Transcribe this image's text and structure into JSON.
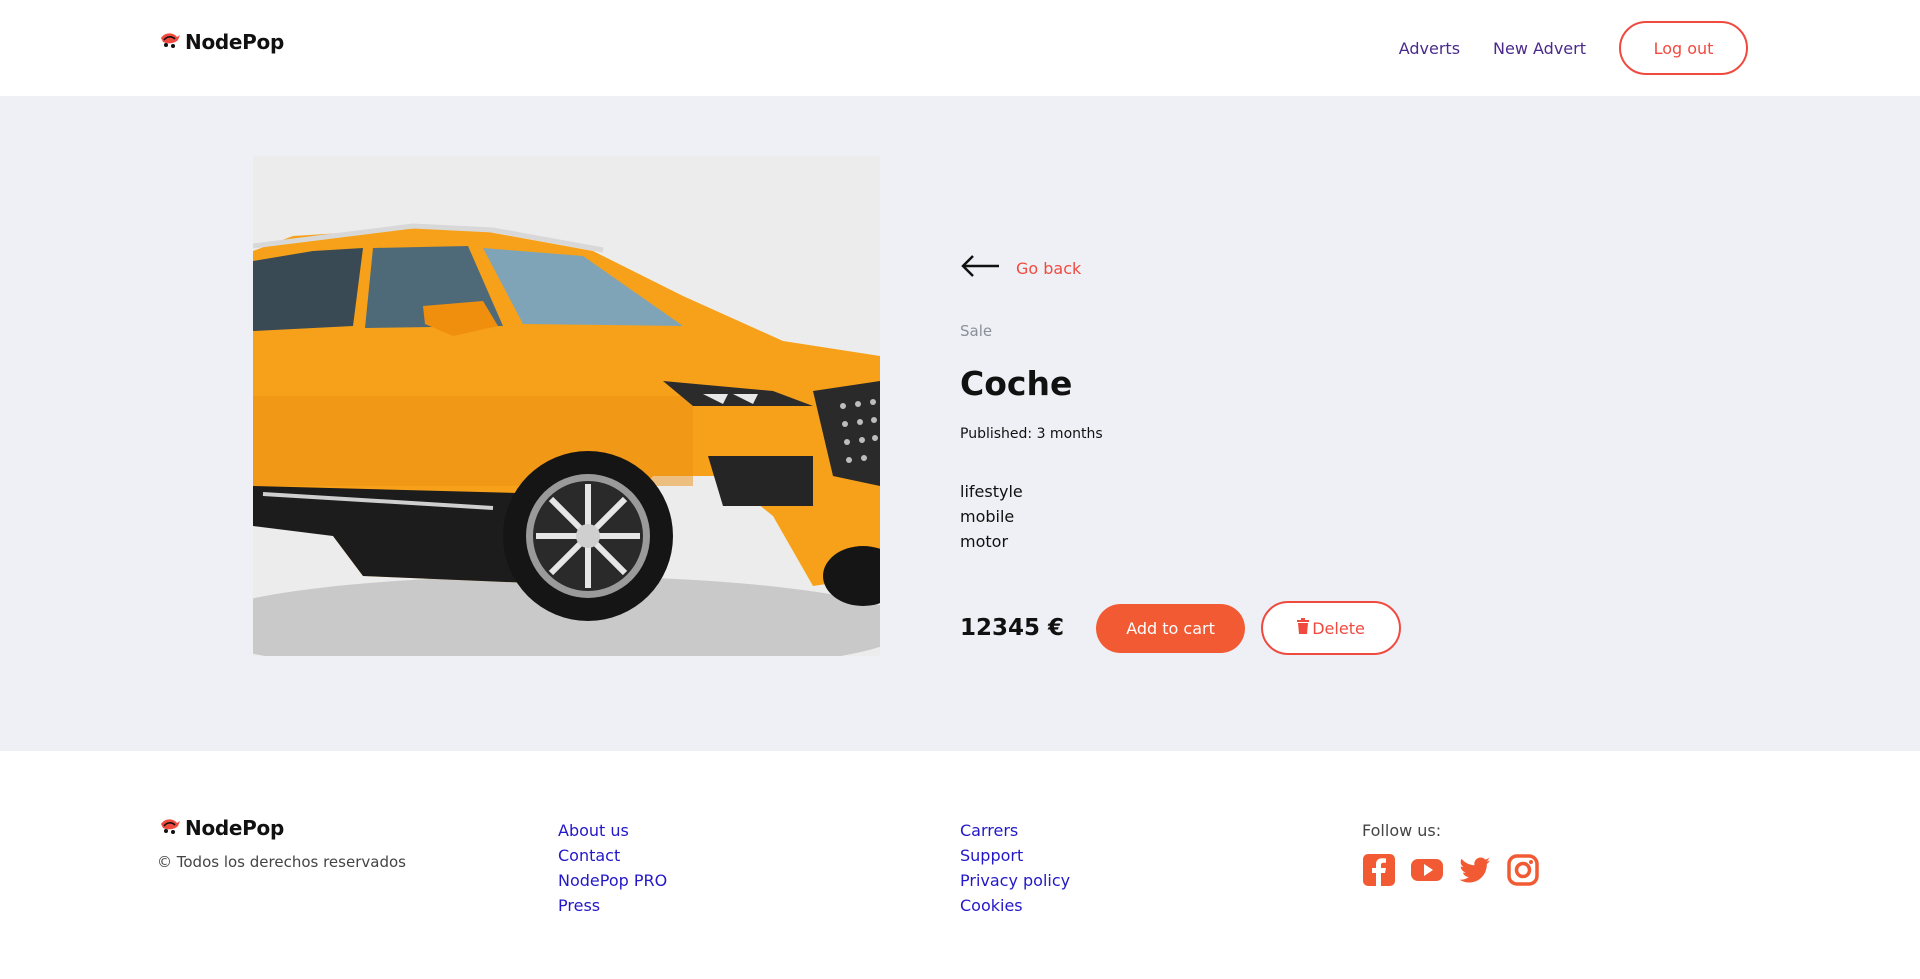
{
  "header": {
    "logo_text": "NodePop",
    "nav": {
      "adverts": "Adverts",
      "new_advert": "New Advert",
      "logout": "Log out"
    }
  },
  "advert": {
    "go_back": "Go back",
    "type": "Sale",
    "name": "Coche",
    "published": "Published: 3 months",
    "tags": [
      "lifestyle",
      "mobile",
      "motor"
    ],
    "price": "12345 €",
    "add_to_cart": "Add to cart",
    "delete": "Delete"
  },
  "footer": {
    "logo_text": "NodePop",
    "copyright": "© Todos los derechos reservados",
    "col1": [
      "About us",
      "Contact",
      "NodePop PRO",
      "Press"
    ],
    "col2": [
      "Carrers",
      "Support",
      "Privacy policy",
      "Cookies"
    ],
    "follow_label": "Follow us:",
    "social": [
      "facebook-icon",
      "youtube-icon",
      "twitter-icon",
      "instagram-icon"
    ]
  },
  "colors": {
    "accent": "#f04a3f",
    "cart_button": "#f25a33",
    "nav_link": "#4a2a8a",
    "footer_link": "#2318c8",
    "main_bg": "#eff0f6"
  }
}
